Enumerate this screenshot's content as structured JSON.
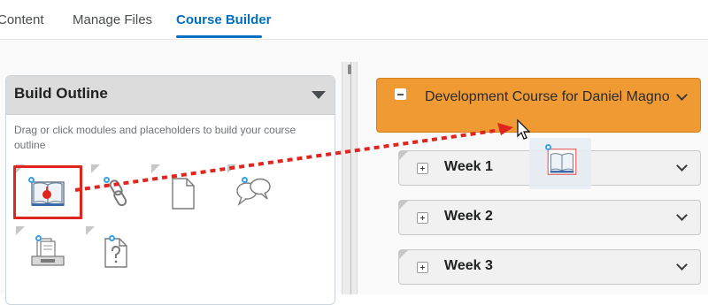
{
  "tabs": {
    "items": [
      {
        "label": "Content"
      },
      {
        "label": "Manage Files"
      },
      {
        "label": "Course Builder"
      }
    ],
    "active": "Course Builder"
  },
  "left_panel": {
    "title": "Build Outline",
    "description": "Drag or click modules and placeholders to build your course outline",
    "tools": [
      {
        "icon": "module-book-icon"
      },
      {
        "icon": "link-icon"
      },
      {
        "icon": "file-icon"
      },
      {
        "icon": "discussion-icon"
      },
      {
        "icon": "dropbox-icon"
      },
      {
        "icon": "quiz-icon"
      }
    ]
  },
  "outline": {
    "course_title": "Development Course for Daniel Magno",
    "weeks": [
      {
        "label": "Week 1"
      },
      {
        "label": "Week 2"
      },
      {
        "label": "Week 3"
      }
    ]
  },
  "colors": {
    "accent": "#006fbf",
    "course_card": "#f09a33",
    "highlight": "#e0251e"
  }
}
